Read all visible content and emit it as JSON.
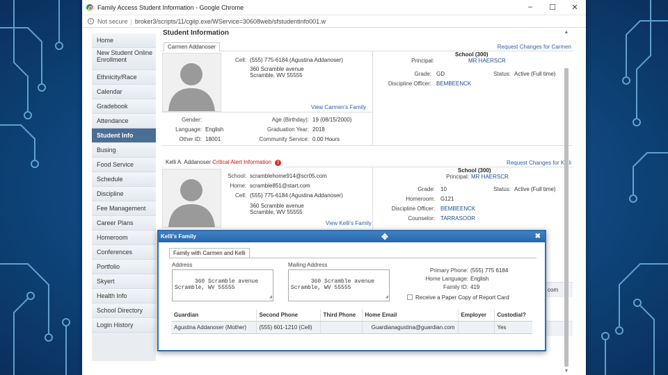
{
  "window": {
    "title": "Family Access Student Information - Google Chrome",
    "not_secure": "Not secure",
    "url": "broker3/scripts/11/cgiip.exe/WService=30608web/sfstudentinfo001.w",
    "minimize": "–",
    "maximize": "☐",
    "close": "✕"
  },
  "sidebar": {
    "items": [
      {
        "label": "Home"
      },
      {
        "label": "New Student Online Enrollment"
      },
      {
        "label": "Ethnicity/Race"
      },
      {
        "label": "Calendar"
      },
      {
        "label": "Gradebook"
      },
      {
        "label": "Attendance"
      },
      {
        "label": "Student Info"
      },
      {
        "label": "Busing"
      },
      {
        "label": "Food Service"
      },
      {
        "label": "Schedule"
      },
      {
        "label": "Discipline"
      },
      {
        "label": "Fee Management"
      },
      {
        "label": "Career Plans"
      },
      {
        "label": "Homeroom"
      },
      {
        "label": "Conferences"
      },
      {
        "label": "Portfolio"
      },
      {
        "label": "Skyert"
      },
      {
        "label": "Health Info"
      },
      {
        "label": "School Directory"
      },
      {
        "label": "Login History"
      }
    ],
    "active": "Student Info"
  },
  "page_title": "Student Information",
  "student1": {
    "tab": "Carmen Addanoser",
    "request_link": "Request Changes for Carmen",
    "cell_label": "Cell:",
    "cell_value": "(555) 775-6184 (Agustina Addanoser)",
    "address": "360 Scramble avenue\nScramble, WV 55555",
    "view_family": "View Carmen's Family",
    "gender_label": "Gender:",
    "gender_value": "",
    "language_label": "Language:",
    "language_value": "English",
    "otherid_label": "Other ID:",
    "otherid_value": "18001",
    "age_label": "Age (Birthday):",
    "age_value": "19 (08/15/2000)",
    "gradyear_label": "Graduation Year:",
    "gradyear_value": "2018",
    "service_label": "Community Service:",
    "service_value": "0.00 Hours",
    "school": "School (300)",
    "principal_label": "Principal:",
    "principal_value": "MR HAERSCR",
    "grade_label": "Grade:",
    "grade_value": "GD",
    "status_label": "Status:",
    "status_value": "Active (Full time)",
    "discipline_label": "Discipline Officer:",
    "discipline_value": "BEMBEENCK"
  },
  "student2": {
    "tab": "Kelli A. Addanoser",
    "critical_alert": "Critical Alert Information",
    "alert_icon": "!",
    "request_link": "Request Changes for Kelli",
    "school_label": "School:",
    "school_email": "scramblehome914@scr05.com",
    "home_label": "Home:",
    "home_email": "scramble851@start.com",
    "cell_label": "Cell:",
    "cell_value": "(555) 775-6184 (Agustina Addanoser)",
    "address": "360 Scramble avenue\nScramble, WV 55555",
    "view_family": "View Kelli's Family",
    "school": "School (300)",
    "principal_label": "Principal:",
    "principal_value": "MR HAERSCR",
    "grade_label": "Grade:",
    "grade_value": "10",
    "status_label": "Status:",
    "status_value": "Active (Full time)",
    "homeroom_label": "Homeroom:",
    "homeroom_value": "G121",
    "discipline_label": "Discipline Officer:",
    "discipline_value": "BEMBEENCK",
    "counselor_label": "Counselor:",
    "counselor_value": "TARRASOOR",
    "partial_email": "com"
  },
  "dialog": {
    "title": "Kelli's Family",
    "close": "✖",
    "tab": "Family with Carmen and Kelli",
    "address_label": "Address",
    "address_value": "360 Scramble avenue\nScramble, WV 55555",
    "mailing_label": "Mailing Address",
    "mailing_value": "360 Scramble avenue\nScramble, WV 55555",
    "primary_phone_label": "Primary Phone:",
    "primary_phone_value": "(555) 775 6184",
    "home_language_label": "Home Language:",
    "home_language_value": "English",
    "family_id_label": "Family ID:",
    "family_id_value": "419",
    "paper_copy_label": "Receive a Paper Copy of Report Card",
    "paper_copy_checked": false,
    "table": {
      "headers": [
        "Guardian",
        "Second Phone",
        "Third Phone",
        "Home Email",
        "Employer",
        "Custodial?"
      ],
      "rows": [
        [
          "Agustina Addanoser (Mother)",
          "(555) 601-1210 (Cell)",
          "",
          "Guardianagustina@guardian.com",
          "",
          "Yes"
        ]
      ]
    }
  }
}
